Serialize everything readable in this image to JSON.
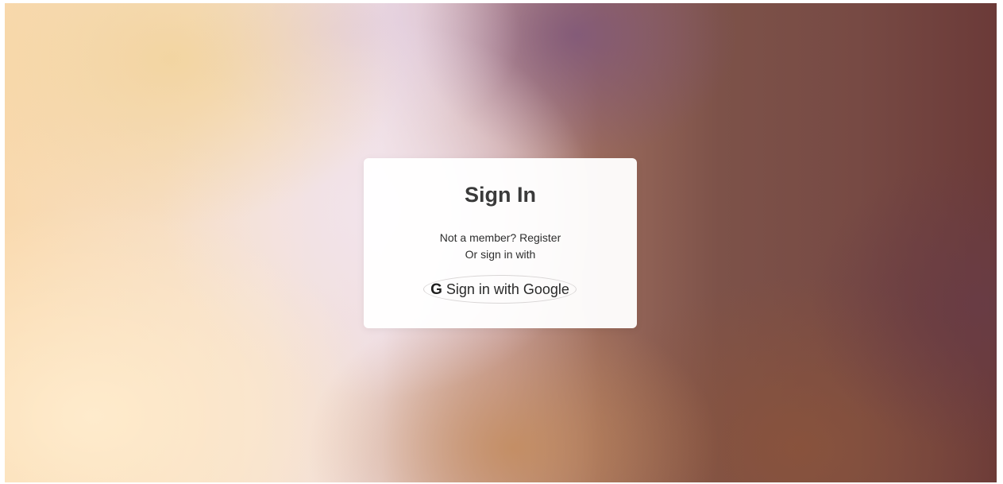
{
  "signin": {
    "title": "Sign In",
    "not_member_prefix": "Not a member? ",
    "register_link": "Register",
    "or_sign_in_with": "Or sign in with",
    "google_button_label": "Sign in with Google",
    "google_icon_glyph": "G",
    "google_icon_name": "google-g-icon"
  },
  "colors": {
    "card_background": "#ffffff",
    "text": "#2e2e2e",
    "button_border": "#d9d6d6"
  }
}
